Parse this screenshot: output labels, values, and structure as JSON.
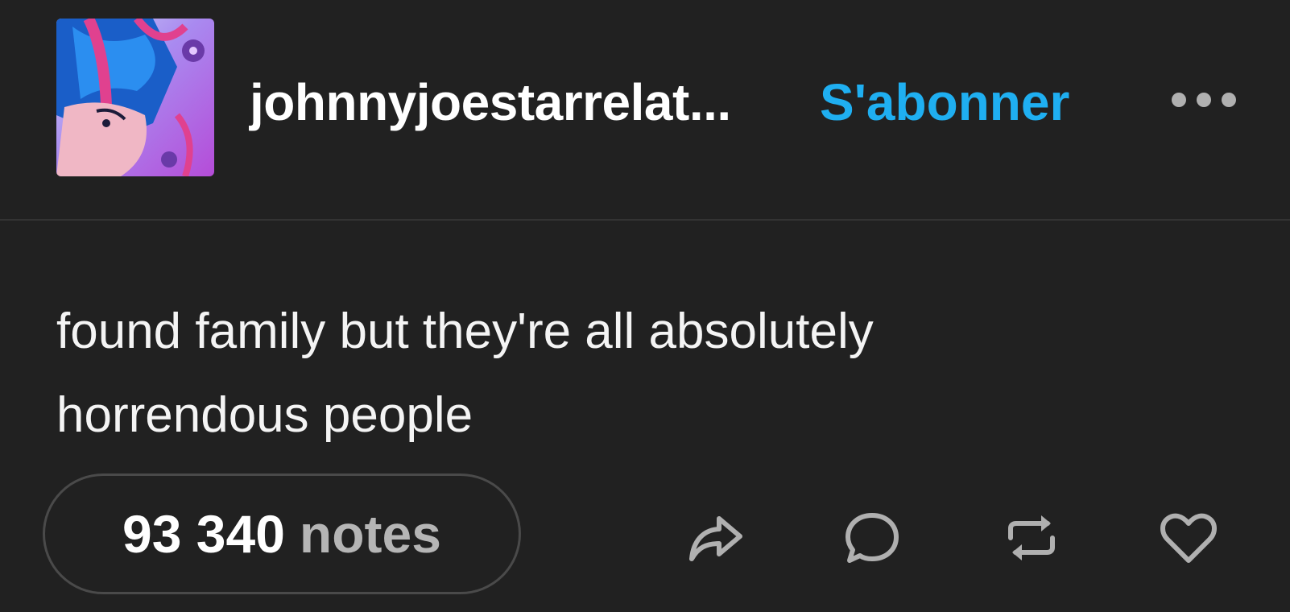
{
  "post": {
    "blog_name": "johnnyjoestarrelat...",
    "follow_label": "S'abonner",
    "text_lines": [
      "found family but they're all absolutely",
      "horrendous people"
    ],
    "notes": {
      "count": "93 340",
      "label": "notes"
    }
  },
  "icons": {
    "more": "more-dots-icon",
    "share": "share-arrow-icon",
    "reply": "reply-bubble-icon",
    "reblog": "reblog-icon",
    "like": "heart-icon"
  },
  "colors": {
    "background": "#212121",
    "accent": "#1faff1",
    "muted_text": "#b5b5b5",
    "icon_gray": "#b0b0b0"
  }
}
